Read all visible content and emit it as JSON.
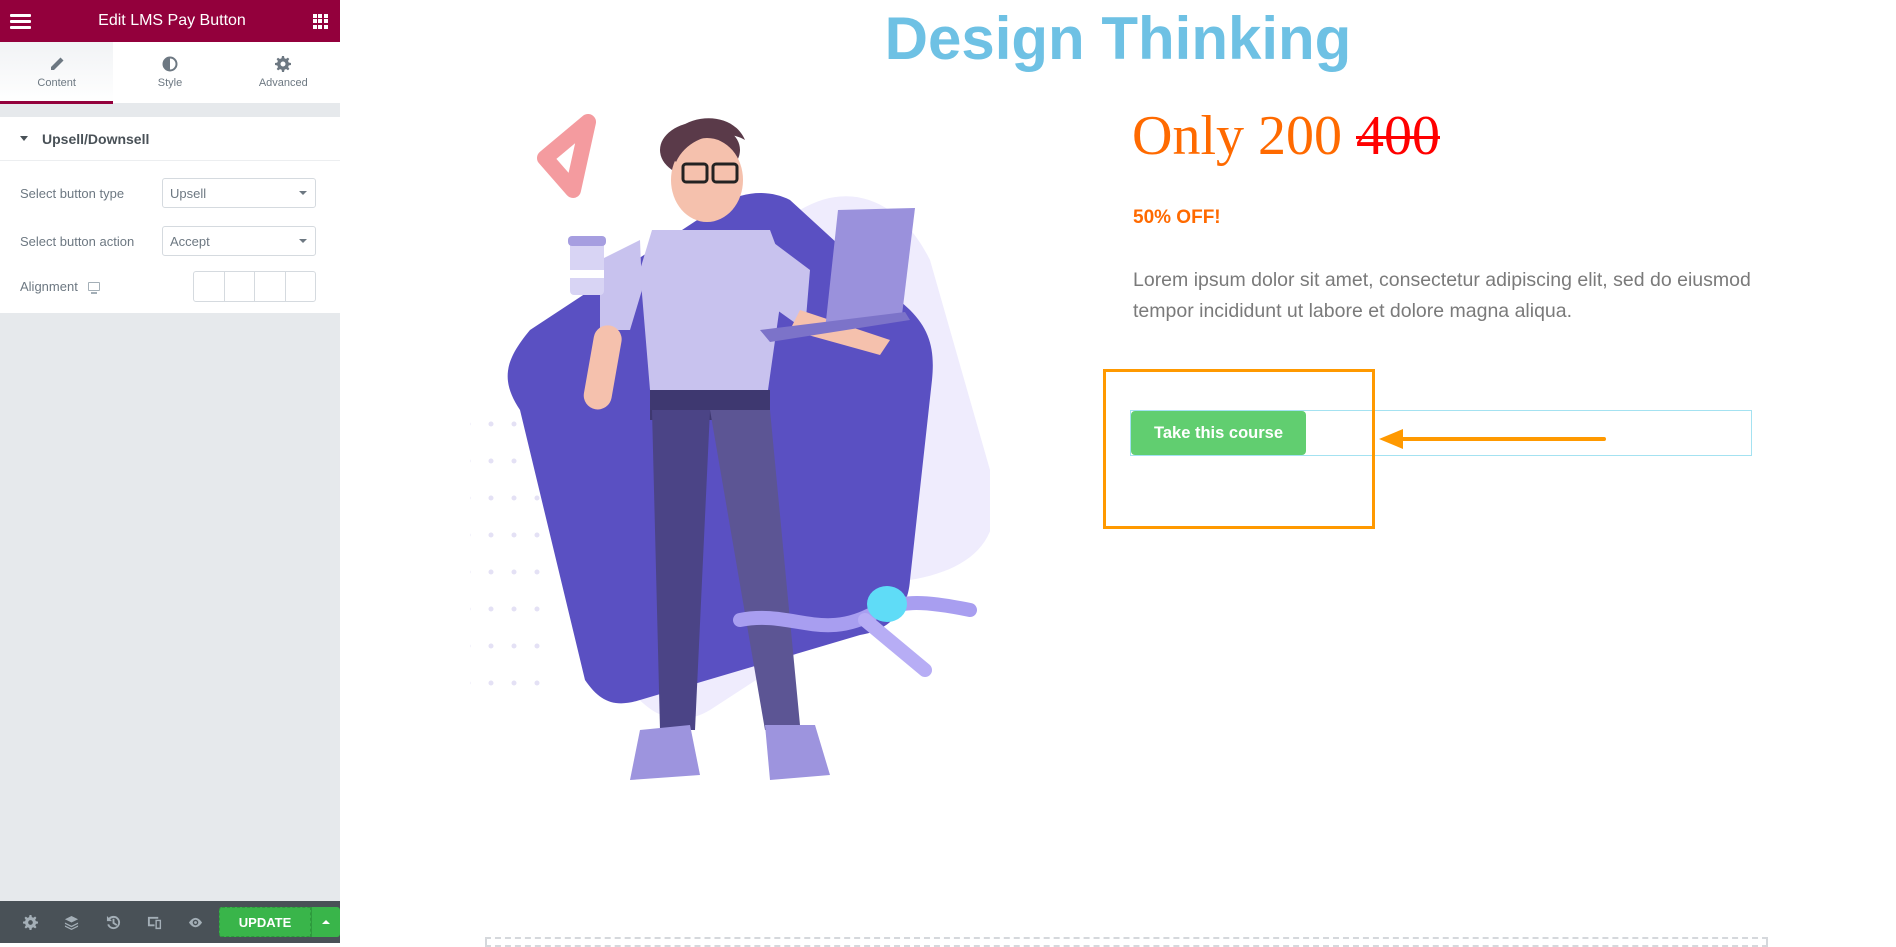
{
  "editor": {
    "header": {
      "title": "Edit LMS Pay Button",
      "menu_icon": "hamburger-icon",
      "apps_icon": "grid-icon"
    },
    "tabs": [
      {
        "label": "Content",
        "icon": "pencil-icon",
        "active": true
      },
      {
        "label": "Style",
        "icon": "contrast-icon",
        "active": false
      },
      {
        "label": "Advanced",
        "icon": "gear-icon",
        "active": false
      }
    ],
    "section": {
      "title": "Upsell/Downsell",
      "controls": [
        {
          "label": "Select button type",
          "value": "Upsell"
        },
        {
          "label": "Select button action",
          "value": "Accept"
        },
        {
          "label": "Alignment",
          "responsive_icon": "desktop-icon"
        }
      ]
    },
    "footer": {
      "icons": [
        "settings-icon",
        "navigator-layers-icon",
        "history-icon",
        "responsive-mode-icon",
        "preview-eye-icon"
      ],
      "update_label": "UPDATE"
    },
    "collapse_glyph": "‹"
  },
  "preview": {
    "title": "Design Thinking",
    "price": {
      "prefix": "Only 200 ",
      "old": "400"
    },
    "discount": "50% OFF!",
    "description": "Lorem ipsum dolor sit amet, consectetur adipiscing elit, sed do eiusmod tempor incididunt ut labore et dolore magna aliqua.",
    "button_label": "Take this course"
  },
  "colors": {
    "editor_brand": "#93003c",
    "update_green": "#39b54a",
    "title_blue": "#6ec1e4",
    "price_orange": "#ff6a00",
    "old_price_red": "#ff0000",
    "button_green": "#61ce70",
    "annotation_orange": "#ff9900"
  }
}
